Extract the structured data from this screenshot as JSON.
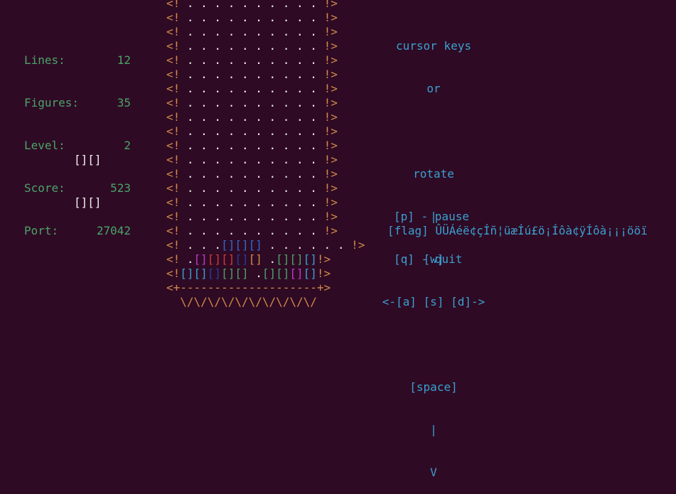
{
  "stats": [
    {
      "label": "Lines:",
      "value": "12"
    },
    {
      "label": "Figures:",
      "value": "35"
    },
    {
      "label": "Level:",
      "value": "2"
    },
    {
      "label": "Score:",
      "value": "523"
    },
    {
      "label": "Port:",
      "value": "27042"
    }
  ],
  "next_piece": [
    "[][]",
    "[][]"
  ],
  "well": {
    "left_wall": "<!",
    "right_wall": "!>",
    "empty_row": " . . . . . . . . . . ",
    "bottom": "<+--------------------+>",
    "base": "  \\/\\/\\/\\/\\/\\/\\/\\/\\/\\/"
  },
  "help": {
    "line1": "cursor keys",
    "line2": "or",
    "rotate": "rotate",
    "bar1": "|",
    "w": "[w]",
    "asd": "<-[a] [s] [d]->",
    "space": "[space]",
    "bar2": "|",
    "v": "V",
    "pause": "[p] - pause",
    "quit": "[q] - quit",
    "flag": "[flag] ÛÜÁéë¢çÍñ¦üæÍú£ö¡Íôà¢ÿÍôà¡¡¡ööï"
  },
  "colors": {
    "background": "#2f0a24",
    "stats": "#4aa36a",
    "wall": "#d08a4a",
    "help": "#3aa0d0"
  }
}
